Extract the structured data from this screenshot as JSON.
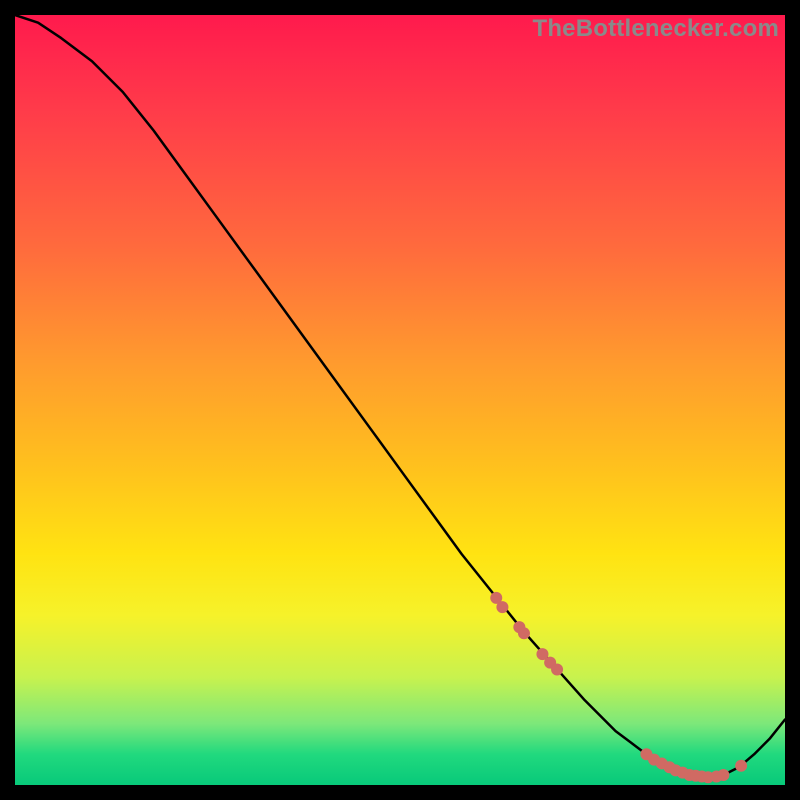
{
  "watermark_text": "TheBottlenecker.com",
  "colors": {
    "background": "#000000",
    "curve": "#000000",
    "marker": "#d06a63",
    "gradient_top": "#ff1a4d",
    "gradient_bottom": "#08c97a"
  },
  "chart_data": {
    "type": "line",
    "title": "",
    "xlabel": "",
    "ylabel": "",
    "xlim": [
      0,
      100
    ],
    "ylim": [
      0,
      100
    ],
    "grid": false,
    "legend": false,
    "series": [
      {
        "name": "curve",
        "x": [
          0,
          3,
          6,
          10,
          14,
          18,
          22,
          26,
          30,
          34,
          38,
          42,
          46,
          50,
          54,
          58,
          62,
          66,
          70,
          74,
          78,
          80,
          82,
          84,
          86,
          88,
          90,
          92,
          94,
          96,
          98,
          100
        ],
        "y": [
          100,
          99,
          97,
          94,
          90,
          85,
          79.5,
          74,
          68.5,
          63,
          57.5,
          52,
          46.5,
          41,
          35.5,
          30,
          25,
          20,
          15.5,
          11,
          7,
          5.5,
          4,
          2.8,
          1.8,
          1.2,
          1,
          1.3,
          2.3,
          4,
          6,
          8.5
        ]
      }
    ],
    "markers": [
      {
        "x": 62.5,
        "y": 24.3
      },
      {
        "x": 63.3,
        "y": 23.1
      },
      {
        "x": 65.5,
        "y": 20.5
      },
      {
        "x": 66.1,
        "y": 19.7
      },
      {
        "x": 68.5,
        "y": 17.0
      },
      {
        "x": 69.5,
        "y": 15.9
      },
      {
        "x": 70.4,
        "y": 15.0
      },
      {
        "x": 82.0,
        "y": 4.0
      },
      {
        "x": 83.0,
        "y": 3.3
      },
      {
        "x": 84.0,
        "y": 2.8
      },
      {
        "x": 85.0,
        "y": 2.3
      },
      {
        "x": 85.8,
        "y": 1.9
      },
      {
        "x": 86.7,
        "y": 1.6
      },
      {
        "x": 87.6,
        "y": 1.3
      },
      {
        "x": 88.4,
        "y": 1.2
      },
      {
        "x": 89.2,
        "y": 1.1
      },
      {
        "x": 90.0,
        "y": 1.0
      },
      {
        "x": 91.1,
        "y": 1.1
      },
      {
        "x": 92.0,
        "y": 1.3
      },
      {
        "x": 94.3,
        "y": 2.5
      }
    ],
    "note": "Axes are abstract 0–100. Curve values estimated from pixel positions; no axis ticks or labels appear in the image."
  }
}
